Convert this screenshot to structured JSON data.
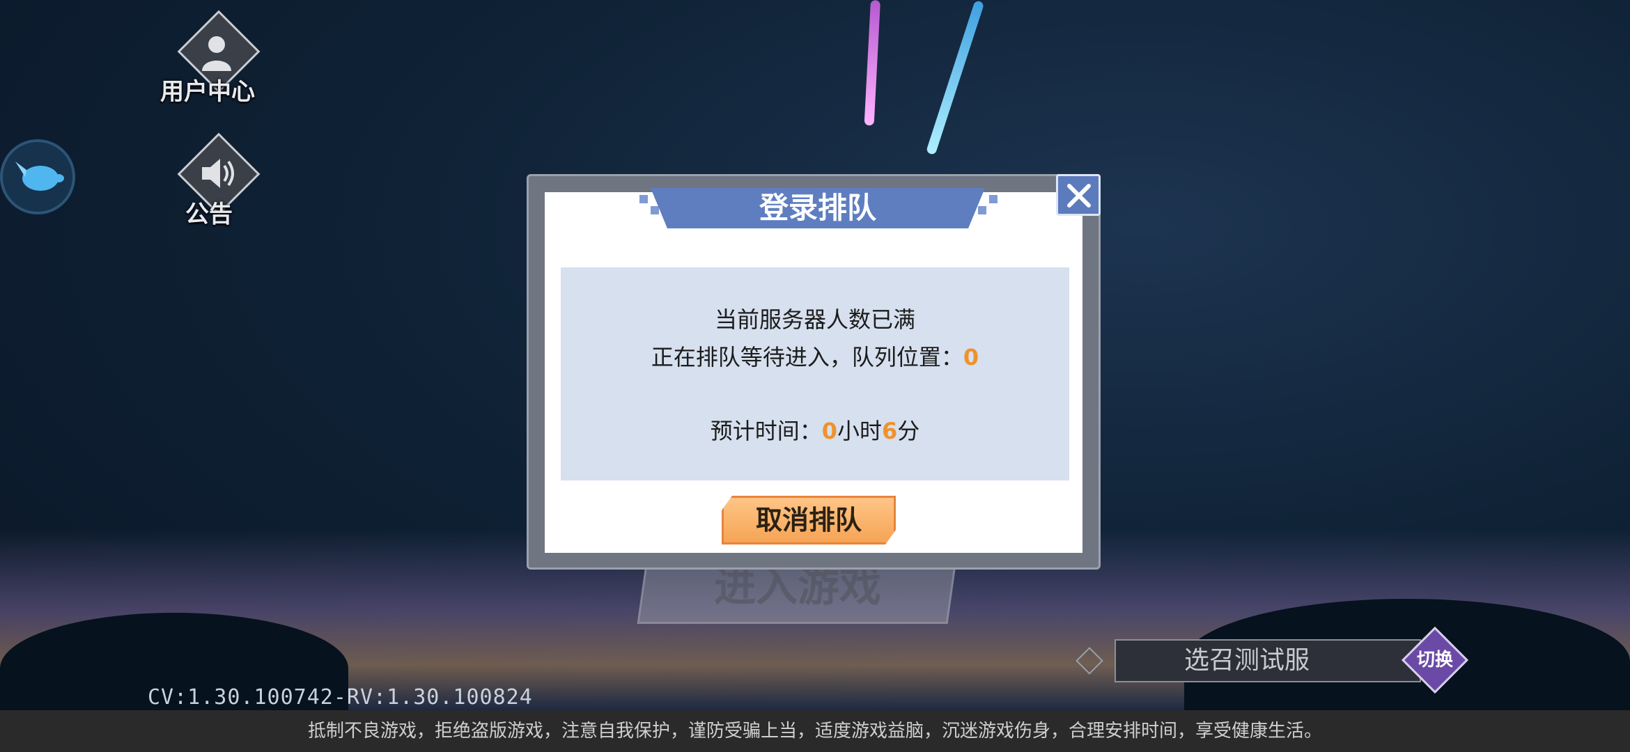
{
  "sidebar": {
    "user_center_label": "用户中心",
    "announcement_label": "公告"
  },
  "dialog": {
    "title": "登录排队",
    "line1": "当前服务器人数已满",
    "line2_prefix": "正在排队等待进入，队列位置：",
    "queue_position": "0",
    "eta_prefix": "预计时间：",
    "eta_hours": "0",
    "eta_hours_unit": "小时",
    "eta_minutes": "6",
    "eta_minutes_unit": "分",
    "cancel_label": "取消排队"
  },
  "background": {
    "enter_game_label": "进入游戏"
  },
  "server": {
    "name": "选召测试服",
    "switch_label": "切换"
  },
  "version": "CV:1.30.100742-RV:1.30.100824",
  "footer": {
    "notice": "抵制不良游戏，拒绝盗版游戏，注意自我保护，谨防受骗上当，适度游戏益脑，沉迷游戏伤身，合理安排时间，享受健康生活。"
  },
  "colors": {
    "accent_blue": "#5f7ec0",
    "orange_highlight": "#f0922c",
    "cancel_button": "#f5a455"
  }
}
